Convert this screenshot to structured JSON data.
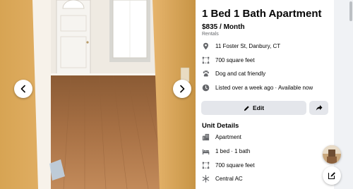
{
  "listing": {
    "title": "1 Bed 1 Bath Apartment",
    "price": "$835 / Month",
    "category": "Rentals",
    "facts": [
      {
        "icon": "location-pin-icon",
        "text": "11 Foster St, Danbury, CT"
      },
      {
        "icon": "floor-area-icon",
        "text": "700 square feet"
      },
      {
        "icon": "paw-icon",
        "text": "Dog and cat friendly"
      },
      {
        "icon": "clock-icon",
        "text": "Listed over a week ago · Available now"
      }
    ]
  },
  "actions": {
    "edit_label": "Edit",
    "edit_icon": "pencil-icon",
    "share_icon": "share-arrow-icon"
  },
  "unit_details": {
    "title": "Unit Details",
    "items": [
      {
        "icon": "building-icon",
        "text": "Apartment"
      },
      {
        "icon": "bed-icon",
        "text": "1 bed · 1 bath"
      },
      {
        "icon": "floor-area-icon",
        "text": "700 square feet"
      },
      {
        "icon": "snowflake-icon",
        "text": "Central AC"
      }
    ]
  },
  "viewer": {
    "prev_icon": "chevron-left-icon",
    "next_icon": "chevron-right-icon"
  },
  "colors": {
    "text_primary": "#050505",
    "text_secondary": "#65676b",
    "icon_gray": "#65676b",
    "button_bg": "#e4e6eb",
    "page_bg": "#f0f2f5"
  }
}
